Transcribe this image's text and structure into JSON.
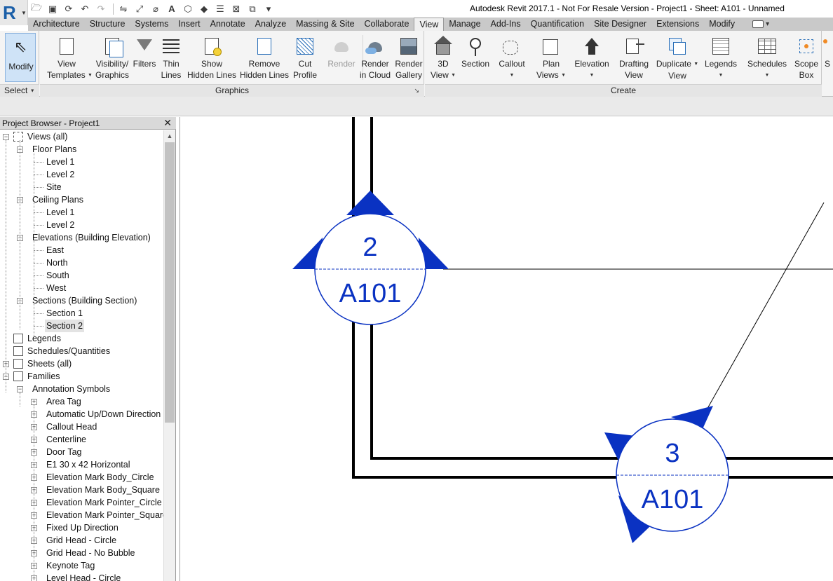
{
  "app": {
    "logo_letter": "R",
    "window_title": "Autodesk Revit 2017.1 - Not For Resale Version -    Project1 - Sheet: A101 - Unnamed"
  },
  "tabs": [
    {
      "label": "Architecture"
    },
    {
      "label": "Structure"
    },
    {
      "label": "Systems"
    },
    {
      "label": "Insert"
    },
    {
      "label": "Annotate"
    },
    {
      "label": "Analyze"
    },
    {
      "label": "Massing & Site"
    },
    {
      "label": "Collaborate"
    },
    {
      "label": "View",
      "active": true
    },
    {
      "label": "Manage"
    },
    {
      "label": "Add-Ins"
    },
    {
      "label": "Quantification"
    },
    {
      "label": "Site Designer"
    },
    {
      "label": "Extensions"
    },
    {
      "label": "Modify"
    }
  ],
  "ribbon": {
    "select_panel": {
      "modify_label": "Modify",
      "title": "Select"
    },
    "graphics_panel": {
      "title": "Graphics",
      "buttons": {
        "view_templates": {
          "line1": "View",
          "line2": "Templates"
        },
        "visibility": {
          "line1": "Visibility/",
          "line2": "Graphics"
        },
        "filters": {
          "line1": "Filters",
          "line2": ""
        },
        "thin_lines": {
          "line1": "Thin",
          "line2": "Lines"
        },
        "show_hidden": {
          "line1": "Show",
          "line2": "Hidden Lines"
        },
        "remove_hidden": {
          "line1": "Remove",
          "line2": "Hidden Lines"
        },
        "cut_profile": {
          "line1": "Cut",
          "line2": "Profile"
        },
        "render": {
          "line1": "Render",
          "line2": ""
        },
        "render_cloud": {
          "line1": "Render",
          "line2": "in Cloud"
        },
        "render_gallery": {
          "line1": "Render",
          "line2": "Gallery"
        }
      }
    },
    "create_panel": {
      "title": "Create",
      "buttons": {
        "view_3d": {
          "line1": "3D",
          "line2": "View"
        },
        "section": {
          "line1": "Section",
          "line2": ""
        },
        "callout": {
          "line1": "Callout",
          "line2": ""
        },
        "plan_views": {
          "line1": "Plan",
          "line2": "Views"
        },
        "elevation": {
          "line1": "Elevation",
          "line2": ""
        },
        "drafting_view": {
          "line1": "Drafting",
          "line2": "View"
        },
        "duplicate_view": {
          "line1": "Duplicate",
          "line2": "View"
        },
        "legends": {
          "line1": "Legends",
          "line2": ""
        },
        "schedules": {
          "line1": "Schedules",
          "line2": ""
        },
        "scope_box": {
          "line1": "Scope",
          "line2": "Box"
        }
      }
    },
    "cut_panel": {
      "label": "S"
    }
  },
  "browser": {
    "title": "Project Browser - Project1",
    "close_glyph": "✕",
    "items": [
      {
        "label": "Views (all)",
        "level": 0,
        "toggle": "−",
        "icon": "views"
      },
      {
        "label": "Floor Plans",
        "level": 1,
        "toggle": "−"
      },
      {
        "label": "Level 1",
        "level": 2
      },
      {
        "label": "Level 2",
        "level": 2
      },
      {
        "label": "Site",
        "level": 2
      },
      {
        "label": "Ceiling Plans",
        "level": 1,
        "toggle": "−"
      },
      {
        "label": "Level 1",
        "level": 2
      },
      {
        "label": "Level 2",
        "level": 2
      },
      {
        "label": "Elevations (Building Elevation)",
        "level": 1,
        "toggle": "−"
      },
      {
        "label": "East",
        "level": 2
      },
      {
        "label": "North",
        "level": 2
      },
      {
        "label": "South",
        "level": 2
      },
      {
        "label": "West",
        "level": 2
      },
      {
        "label": "Sections (Building Section)",
        "level": 1,
        "toggle": "−"
      },
      {
        "label": "Section 1",
        "level": 2
      },
      {
        "label": "Section 2",
        "level": 2,
        "selected": true
      },
      {
        "label": "Legends",
        "level": 0,
        "icon": "legend"
      },
      {
        "label": "Schedules/Quantities",
        "level": 0,
        "icon": "schedule"
      },
      {
        "label": "Sheets (all)",
        "level": 0,
        "toggle": "+",
        "icon": "sheet"
      },
      {
        "label": "Families",
        "level": 0,
        "toggle": "−",
        "icon": "family"
      },
      {
        "label": "Annotation Symbols",
        "level": 1,
        "toggle": "−"
      },
      {
        "label": "Area Tag",
        "level": 2,
        "toggle": "+"
      },
      {
        "label": "Automatic Up/Down Direction",
        "level": 2,
        "toggle": "+"
      },
      {
        "label": "Callout Head",
        "level": 2,
        "toggle": "+"
      },
      {
        "label": "Centerline",
        "level": 2,
        "toggle": "+"
      },
      {
        "label": "Door Tag",
        "level": 2,
        "toggle": "+"
      },
      {
        "label": "E1 30 x 42 Horizontal",
        "level": 2,
        "toggle": "+"
      },
      {
        "label": "Elevation Mark Body_Circle",
        "level": 2,
        "toggle": "+"
      },
      {
        "label": "Elevation Mark Body_Square",
        "level": 2,
        "toggle": "+"
      },
      {
        "label": "Elevation Mark Pointer_Circle",
        "level": 2,
        "toggle": "+"
      },
      {
        "label": "Elevation Mark Pointer_Square",
        "level": 2,
        "toggle": "+"
      },
      {
        "label": "Fixed Up Direction",
        "level": 2,
        "toggle": "+"
      },
      {
        "label": "Grid Head - Circle",
        "level": 2,
        "toggle": "+"
      },
      {
        "label": "Grid Head - No Bubble",
        "level": 2,
        "toggle": "+"
      },
      {
        "label": "Keynote Tag",
        "level": 2,
        "toggle": "+"
      },
      {
        "label": "Level Head - Circle",
        "level": 2,
        "toggle": "+"
      }
    ]
  },
  "canvas": {
    "marker_2": {
      "number": "2",
      "sheet": "A101"
    },
    "marker_3": {
      "number": "3",
      "sheet": "A101"
    },
    "marker_color": "#0a32c2"
  }
}
